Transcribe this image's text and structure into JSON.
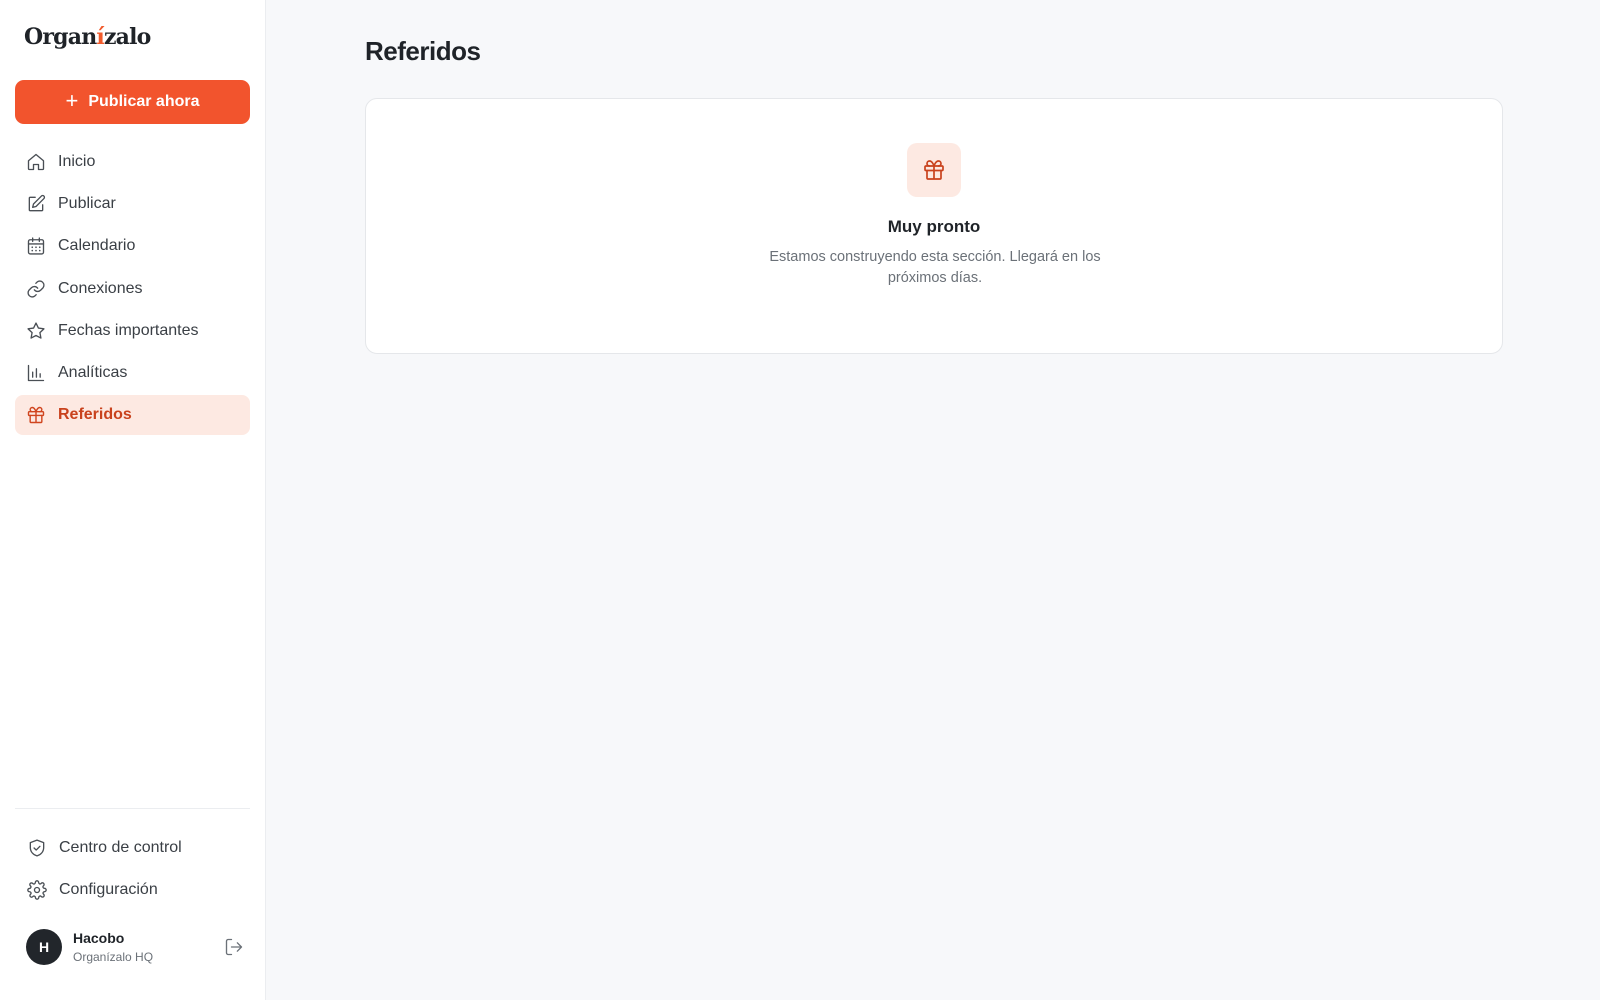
{
  "brand": {
    "logo_pre": "Organ",
    "logo_accent": "í",
    "logo_post": "zalo"
  },
  "sidebar": {
    "publish_button": "Publicar ahora",
    "items": [
      {
        "label": "Inicio",
        "icon": "home-icon"
      },
      {
        "label": "Publicar",
        "icon": "edit-icon"
      },
      {
        "label": "Calendario",
        "icon": "calendar-icon"
      },
      {
        "label": "Conexiones",
        "icon": "link-icon"
      },
      {
        "label": "Fechas importantes",
        "icon": "star-icon"
      },
      {
        "label": "Analíticas",
        "icon": "bar-chart-icon"
      },
      {
        "label": "Referidos",
        "icon": "gift-icon",
        "active": true
      }
    ],
    "bottom_items": [
      {
        "label": "Centro de control",
        "icon": "shield-check-icon"
      },
      {
        "label": "Configuración",
        "icon": "gear-icon"
      }
    ]
  },
  "user": {
    "initial": "H",
    "name": "Hacobo",
    "org": "Organízalo HQ"
  },
  "main": {
    "title": "Referidos",
    "empty_state": {
      "icon": "gift-icon",
      "title": "Muy pronto",
      "text": "Estamos construyendo esta sección. Llegará en los próximos días."
    }
  },
  "colors": {
    "accent": "#f2542d",
    "accent_soft": "#fde9e2",
    "accent_text": "#c9421d",
    "background": "#f7f8fa"
  }
}
